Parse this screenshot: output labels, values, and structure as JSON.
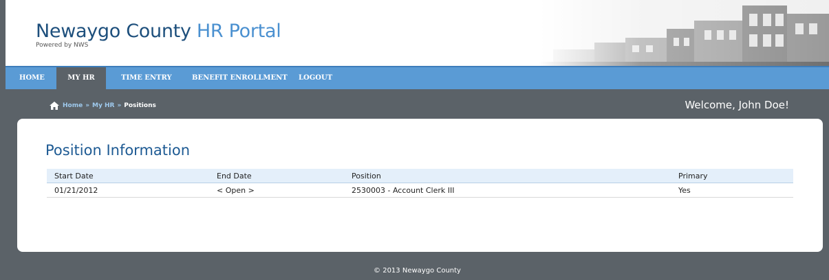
{
  "header": {
    "title_main": "Newaygo County",
    "title_accent": "HR Portal",
    "powered_by": "Powered by NWS",
    "photo_icon": "historic-street-photo"
  },
  "nav": {
    "items": [
      {
        "label": "HOME"
      },
      {
        "label": "MY HR"
      },
      {
        "label": "TIME ENTRY"
      },
      {
        "label": "BENEFIT ENROLLMENT"
      },
      {
        "label": "LOGOUT"
      }
    ],
    "active": "MY HR"
  },
  "breadcrumb": {
    "icon": "home-icon",
    "items": [
      "Home",
      "My HR",
      "Positions"
    ],
    "separator": "»"
  },
  "welcome": "Welcome, John Doe!",
  "main": {
    "title": "Position Information",
    "table": {
      "headers": [
        "Start Date",
        "End Date",
        "Position",
        "Primary"
      ],
      "rows": [
        [
          "01/21/2012",
          "< Open >",
          "2530003 - Account Clerk III",
          "Yes"
        ]
      ]
    }
  },
  "footer": "© 2013 Newaygo County",
  "colors": {
    "nav_bg": "#5a9bd5",
    "band_bg": "#5b6268",
    "title_dark": "#1d4f7c",
    "title_accent": "#4a90d0",
    "table_header_bg": "#e4effa"
  }
}
